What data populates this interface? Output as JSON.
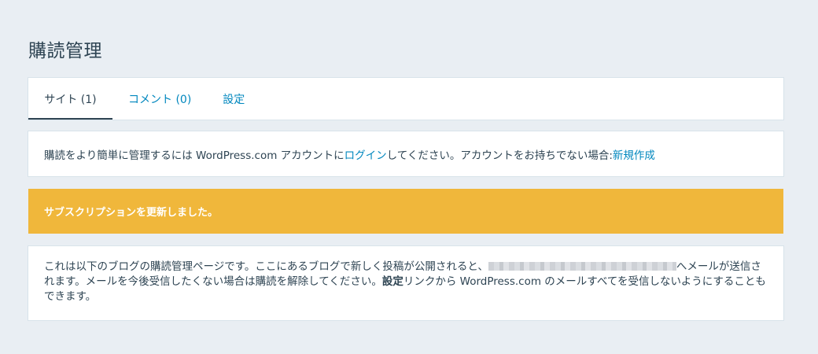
{
  "page": {
    "title": "購読管理"
  },
  "tabs": {
    "sites": "サイト (1)",
    "comments": "コメント (0)",
    "settings": "設定"
  },
  "notice": {
    "text_before": "購読をより簡単に管理するには WordPress.com アカウントに",
    "login_link": "ログイン",
    "text_middle": "してください。アカウントをお持ちでない場合: ",
    "signup_link": "新規作成"
  },
  "banner": {
    "message": "サブスクリプションを更新しました。",
    "color": "#f0b73b"
  },
  "info": {
    "text_before_email": "これは以下のブログの購読管理ページです。ここにあるブログで新しく投稿が公開されると、",
    "text_after_email": "へメールが送信されます。メールを今後受信したくない場合は購読を解除してください。",
    "settings_bold": "設定",
    "text_end": "リンクから WordPress.com のメールすべてを受信しないようにすることもできます。"
  },
  "colors": {
    "background": "#e9eef3",
    "link": "#0087be",
    "text": "#2e4453"
  }
}
